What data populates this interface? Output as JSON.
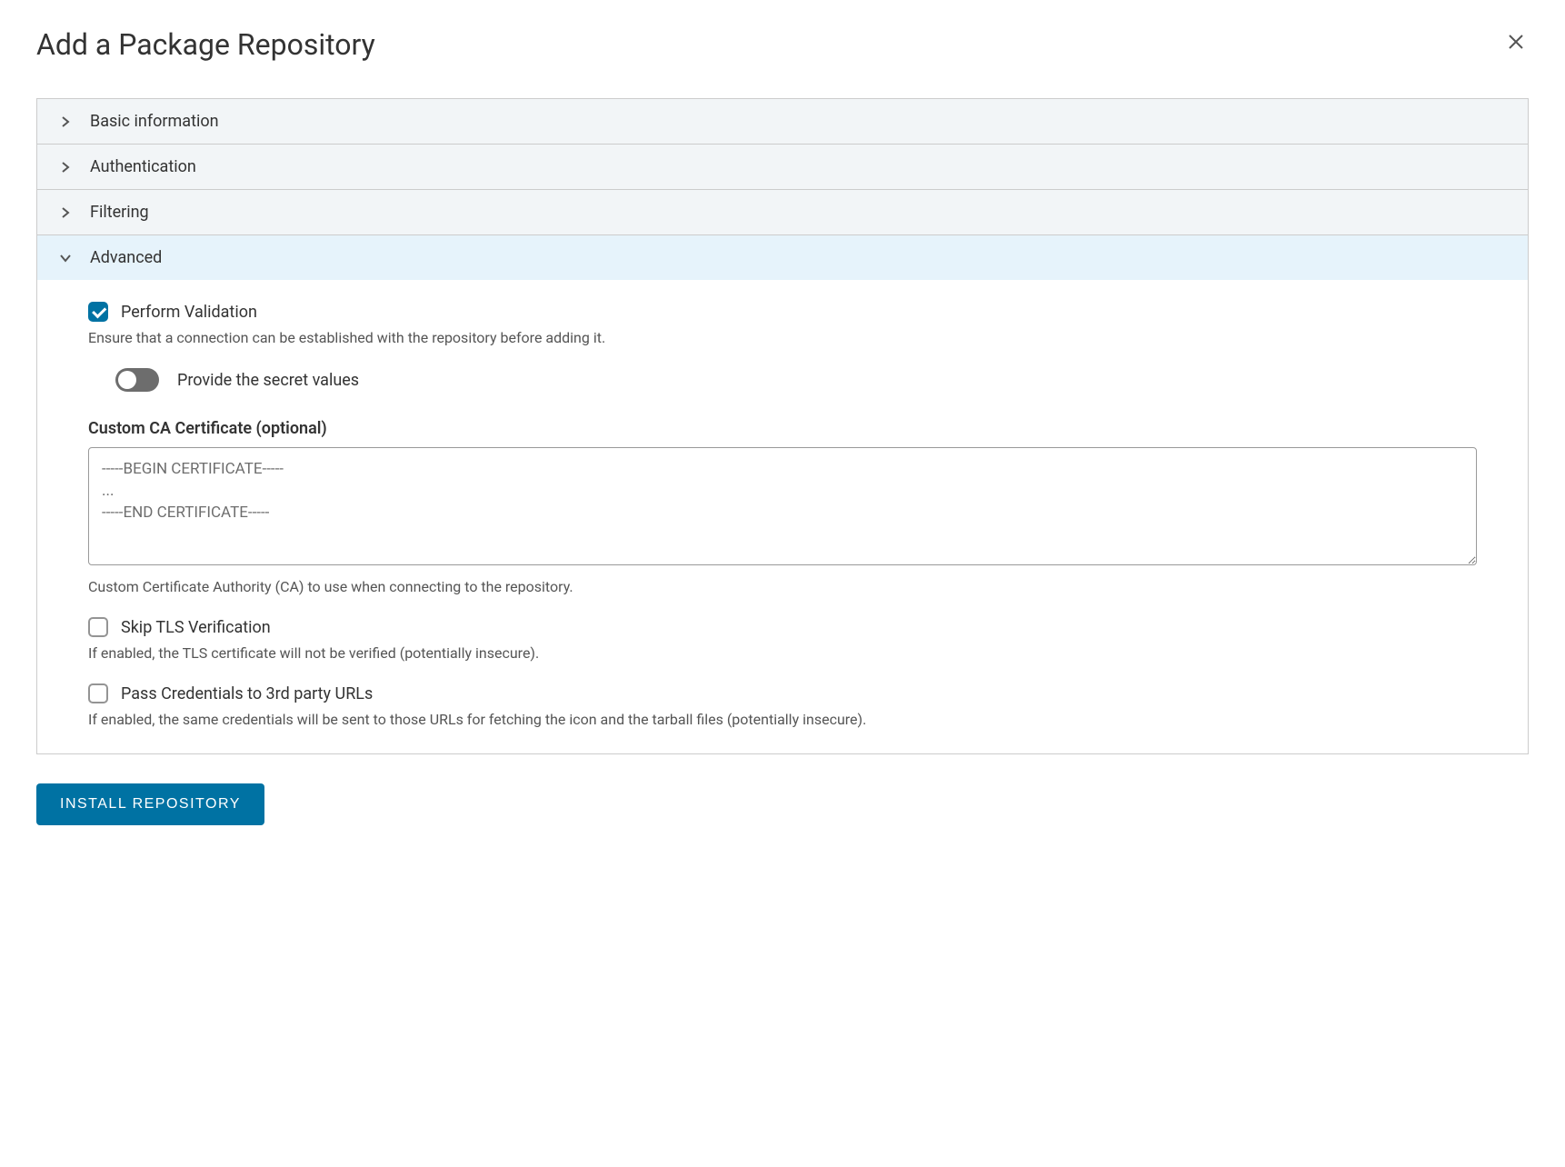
{
  "modal": {
    "title": "Add a Package Repository"
  },
  "sections": [
    {
      "label": "Basic information"
    },
    {
      "label": "Authentication"
    },
    {
      "label": "Filtering"
    },
    {
      "label": "Advanced"
    }
  ],
  "advanced": {
    "perform_validation": {
      "label": "Perform Validation",
      "help": "Ensure that a connection can be established with the repository before adding it.",
      "checked": true
    },
    "provide_secret": {
      "label": "Provide the secret values",
      "enabled": false
    },
    "custom_ca": {
      "label": "Custom CA Certificate (optional)",
      "placeholder": "-----BEGIN CERTIFICATE-----\n...\n-----END CERTIFICATE-----",
      "help": "Custom Certificate Authority (CA) to use when connecting to the repository.",
      "value": ""
    },
    "skip_tls": {
      "label": "Skip TLS Verification",
      "help": "If enabled, the TLS certificate will not be verified (potentially insecure).",
      "checked": false
    },
    "pass_credentials": {
      "label": "Pass Credentials to 3rd party URLs",
      "help": "If enabled, the same credentials will be sent to those URLs for fetching the icon and the tarball files (potentially insecure).",
      "checked": false
    }
  },
  "actions": {
    "install_label": "INSTALL REPOSITORY"
  }
}
